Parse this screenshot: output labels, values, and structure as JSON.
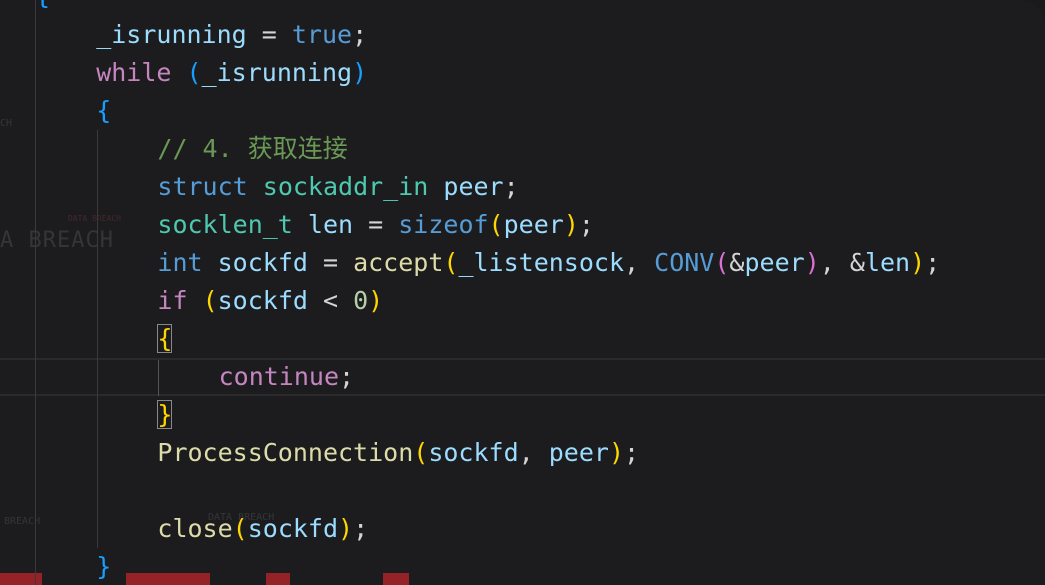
{
  "background": {
    "texts": [
      "CH",
      "A BREACH",
      "DATA BREACH",
      "BREACH",
      "DATA BREACH"
    ],
    "accent": "#aa2328"
  },
  "code": {
    "top_brace": "{",
    "lines": [
      {
        "indent": "    ",
        "tokens": [
          {
            "t": "_isrunning",
            "c": "var"
          },
          {
            "t": " = ",
            "c": "op"
          },
          {
            "t": "true",
            "c": "kw-blue"
          },
          {
            "t": ";",
            "c": "op"
          }
        ]
      },
      {
        "indent": "    ",
        "tokens": [
          {
            "t": "while",
            "c": "kw-purple"
          },
          {
            "t": " ",
            "c": "op"
          },
          {
            "t": "(",
            "c": "p3"
          },
          {
            "t": "_isrunning",
            "c": "var"
          },
          {
            "t": ")",
            "c": "p3"
          }
        ]
      },
      {
        "indent": "    ",
        "tokens": [
          {
            "t": "{",
            "c": "p3"
          }
        ]
      },
      {
        "indent": "        ",
        "tokens": [
          {
            "t": "// 4. 获取连接",
            "c": "comment"
          }
        ]
      },
      {
        "indent": "        ",
        "tokens": [
          {
            "t": "struct",
            "c": "kw-blue"
          },
          {
            "t": " ",
            "c": "op"
          },
          {
            "t": "sockaddr_in",
            "c": "type"
          },
          {
            "t": " ",
            "c": "op"
          },
          {
            "t": "peer",
            "c": "var"
          },
          {
            "t": ";",
            "c": "op"
          }
        ]
      },
      {
        "indent": "        ",
        "tokens": [
          {
            "t": "socklen_t",
            "c": "type"
          },
          {
            "t": " ",
            "c": "op"
          },
          {
            "t": "len",
            "c": "var"
          },
          {
            "t": " = ",
            "c": "op"
          },
          {
            "t": "sizeof",
            "c": "kw-blue"
          },
          {
            "t": "(",
            "c": "p1"
          },
          {
            "t": "peer",
            "c": "var"
          },
          {
            "t": ")",
            "c": "p1"
          },
          {
            "t": ";",
            "c": "op"
          }
        ]
      },
      {
        "indent": "        ",
        "tokens": [
          {
            "t": "int",
            "c": "kw-blue"
          },
          {
            "t": " ",
            "c": "op"
          },
          {
            "t": "sockfd",
            "c": "var"
          },
          {
            "t": " = ",
            "c": "op"
          },
          {
            "t": "accept",
            "c": "func"
          },
          {
            "t": "(",
            "c": "p1"
          },
          {
            "t": "_listensock",
            "c": "var"
          },
          {
            "t": ", ",
            "c": "op"
          },
          {
            "t": "CONV",
            "c": "macro"
          },
          {
            "t": "(",
            "c": "p2"
          },
          {
            "t": "&",
            "c": "op"
          },
          {
            "t": "peer",
            "c": "var"
          },
          {
            "t": ")",
            "c": "p2"
          },
          {
            "t": ", ",
            "c": "op"
          },
          {
            "t": "&",
            "c": "op"
          },
          {
            "t": "len",
            "c": "var"
          },
          {
            "t": ")",
            "c": "p1"
          },
          {
            "t": ";",
            "c": "op"
          }
        ]
      },
      {
        "indent": "        ",
        "tokens": [
          {
            "t": "if",
            "c": "kw-purple"
          },
          {
            "t": " ",
            "c": "op"
          },
          {
            "t": "(",
            "c": "p1"
          },
          {
            "t": "sockfd",
            "c": "var"
          },
          {
            "t": " < ",
            "c": "op"
          },
          {
            "t": "0",
            "c": "num"
          },
          {
            "t": ")",
            "c": "p1"
          }
        ]
      },
      {
        "indent": "        ",
        "tokens": [
          {
            "t": "{",
            "c": "p1 bracket-match"
          }
        ]
      },
      {
        "indent": "            ",
        "tokens": [
          {
            "t": "continue",
            "c": "kw-purple"
          },
          {
            "t": ";",
            "c": "op"
          }
        ]
      },
      {
        "indent": "        ",
        "tokens": [
          {
            "t": "}",
            "c": "p1 bracket-match"
          }
        ]
      },
      {
        "indent": "        ",
        "tokens": [
          {
            "t": "ProcessConnection",
            "c": "func"
          },
          {
            "t": "(",
            "c": "p1"
          },
          {
            "t": "sockfd",
            "c": "var"
          },
          {
            "t": ", ",
            "c": "op"
          },
          {
            "t": "peer",
            "c": "var"
          },
          {
            "t": ")",
            "c": "p1"
          },
          {
            "t": ";",
            "c": "op"
          }
        ]
      },
      {
        "indent": "",
        "tokens": []
      },
      {
        "indent": "        ",
        "tokens": [
          {
            "t": "close",
            "c": "func"
          },
          {
            "t": "(",
            "c": "p1"
          },
          {
            "t": "sockfd",
            "c": "var"
          },
          {
            "t": ")",
            "c": "p1"
          },
          {
            "t": ";",
            "c": "op"
          }
        ]
      },
      {
        "indent": "    ",
        "tokens": [
          {
            "t": "}",
            "c": "p3"
          }
        ]
      }
    ]
  }
}
